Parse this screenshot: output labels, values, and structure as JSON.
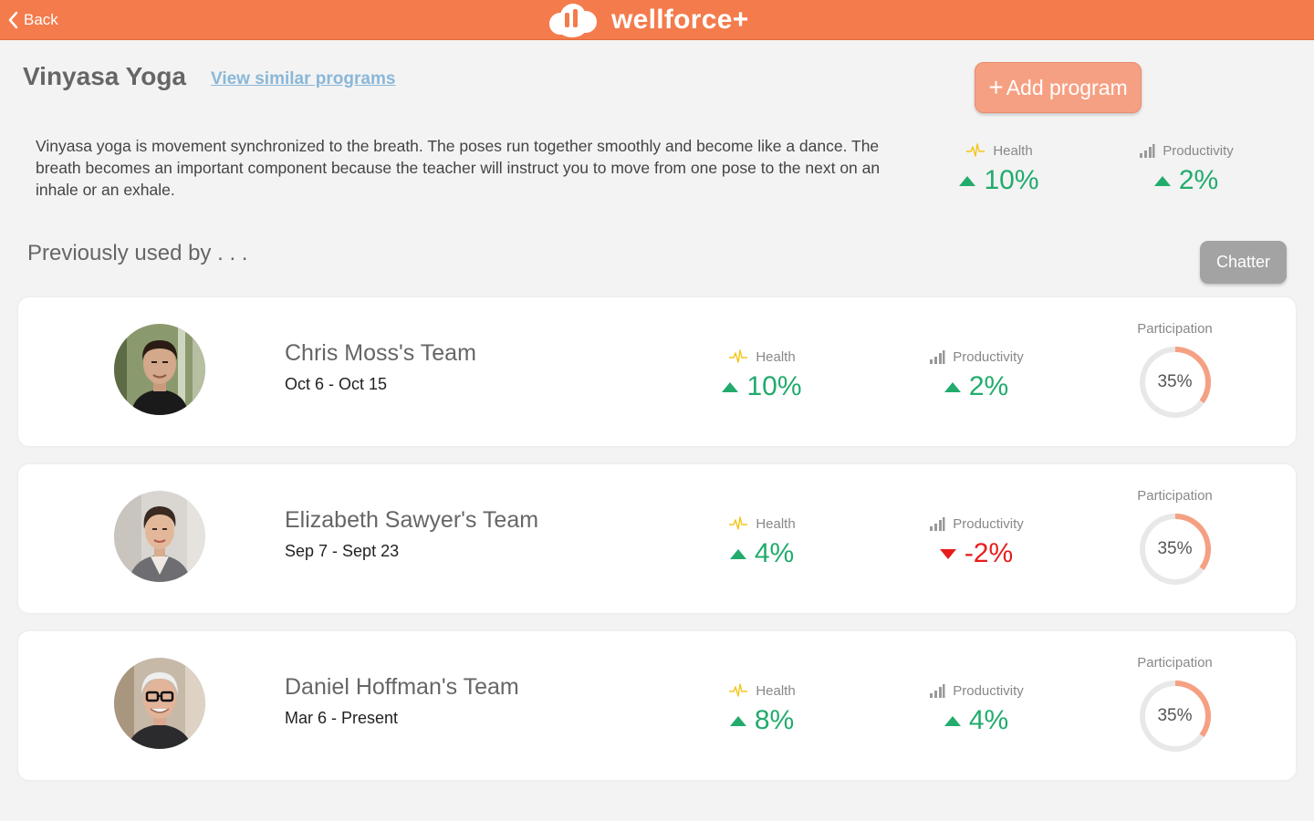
{
  "header": {
    "back_label": "Back",
    "brand_name": "wellforce+"
  },
  "program": {
    "title": "Vinyasa Yoga",
    "similar_link": "View similar programs",
    "add_button": "Add program",
    "description": "Vinyasa yoga is movement synchronized to the breath. The poses run together smoothly and become like a dance. The breath becomes an important component because the teacher will instruct you to move from one pose to the next on an inhale or an exhale.",
    "health_label": "Health",
    "health_value": "10%",
    "productivity_label": "Productivity",
    "productivity_value": "2%"
  },
  "section": {
    "previously_used_label": "Previously used by . . .",
    "chatter_button": "Chatter"
  },
  "teams": [
    {
      "name": "Chris Moss's Team",
      "dates": "Oct 6 - Oct 15",
      "health_label": "Health",
      "health_value": "10%",
      "health_trend": "up",
      "productivity_label": "Productivity",
      "productivity_value": "2%",
      "productivity_trend": "up",
      "participation_label": "Participation",
      "participation_value": "35%",
      "participation_fraction": 0.35
    },
    {
      "name": "Elizabeth Sawyer's Team",
      "dates": "Sep 7 - Sept 23",
      "health_label": "Health",
      "health_value": "4%",
      "health_trend": "up",
      "productivity_label": "Productivity",
      "productivity_value": "-2%",
      "productivity_trend": "down",
      "participation_label": "Participation",
      "participation_value": "35%",
      "participation_fraction": 0.35
    },
    {
      "name": "Daniel Hoffman's Team",
      "dates": "Mar 6 - Present",
      "health_label": "Health",
      "health_value": "8%",
      "health_trend": "up",
      "productivity_label": "Productivity",
      "productivity_value": "4%",
      "productivity_trend": "up",
      "participation_label": "Participation",
      "participation_value": "35%",
      "participation_fraction": 0.35
    }
  ],
  "colors": {
    "brand": "#f47b4c",
    "add_button": "#f6a083",
    "positive": "#22ab6d",
    "negative": "#e71d1d",
    "participation_arc": "#f6a083",
    "participation_track": "#e8e8e8",
    "health_icon": "#f5c518",
    "productivity_icon": "#999999"
  },
  "icons": {
    "back": "chevron-left-icon",
    "brand": "cloud-logo",
    "health": "heartbeat-icon",
    "productivity": "bar-signal-icon",
    "trend_up": "triangle-up-icon",
    "trend_down": "triangle-down-icon"
  }
}
